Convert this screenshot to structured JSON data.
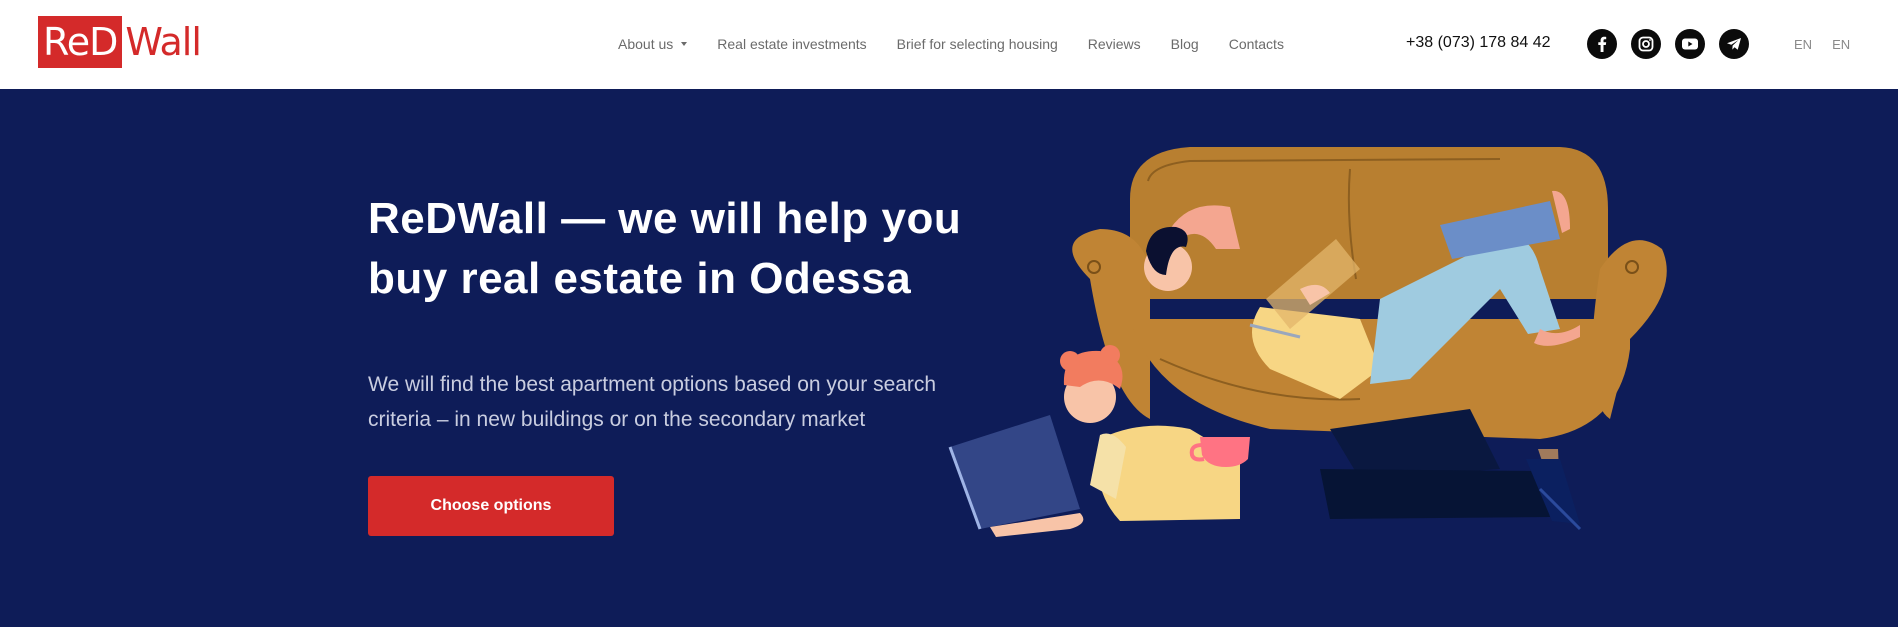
{
  "brand": {
    "logo_boxed": "ReD",
    "logo_rest": "Wall",
    "accent_color": "#d42a2a",
    "hero_background": "#0e1c58"
  },
  "nav": {
    "items": [
      {
        "label": "About us",
        "has_dropdown": true
      },
      {
        "label": "Real estate investments"
      },
      {
        "label": "Brief for selecting housing"
      },
      {
        "label": "Reviews"
      },
      {
        "label": "Blog"
      },
      {
        "label": "Contacts"
      }
    ]
  },
  "contact": {
    "phone": "+38 (073) 178 84 42"
  },
  "socials": [
    {
      "icon": "facebook-icon"
    },
    {
      "icon": "instagram-icon"
    },
    {
      "icon": "youtube-icon"
    },
    {
      "icon": "telegram-icon"
    }
  ],
  "languages": [
    "EN",
    "EN"
  ],
  "hero": {
    "title_line1": "ReDWall — we will help you",
    "title_line2": "buy real estate in Odessa",
    "subtitle_line1": "We will find the best apartment options based on your search",
    "subtitle_line2": "criteria – in new buildings or on the secondary market",
    "cta_label": "Choose options"
  }
}
